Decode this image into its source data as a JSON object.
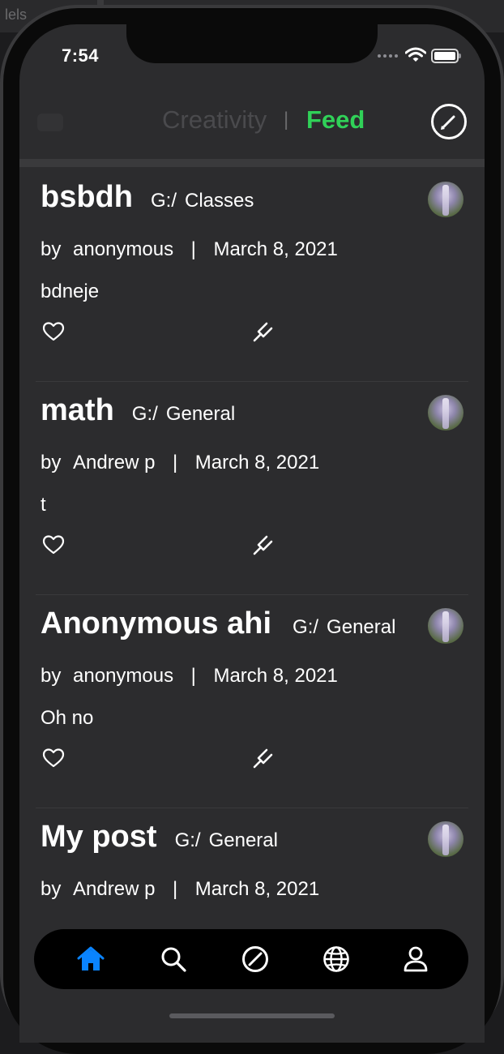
{
  "backdrop": {
    "text": "lels"
  },
  "status_bar": {
    "time": "7:54"
  },
  "header": {
    "segment_left": "Creativity",
    "separator": "|",
    "segment_right": "Feed",
    "accent_color": "#30d158",
    "compose_icon": "compose-icon"
  },
  "posts": [
    {
      "title": "bsbdh",
      "group_prefix": "G:/",
      "group": "Classes",
      "by": "by",
      "author": "anonymous",
      "separator": "|",
      "date": "March 8, 2021",
      "body": "bdneje"
    },
    {
      "title": "math",
      "group_prefix": "G:/",
      "group": "General",
      "by": "by",
      "author": "Andrew p",
      "separator": "|",
      "date": "March 8, 2021",
      "body": "t"
    },
    {
      "title": "Anonymous ahi",
      "group_prefix": "G:/",
      "group": "General",
      "by": "by",
      "author": "anonymous",
      "separator": "|",
      "date": "March 8, 2021",
      "body": "Oh no"
    },
    {
      "title": "My post",
      "group_prefix": "G:/",
      "group": "General",
      "by": "by",
      "author": "Andrew p",
      "separator": "|",
      "date": "March 8, 2021",
      "body": ""
    }
  ],
  "tabbar": {
    "active_color": "#0a84ff",
    "items": [
      "home-icon",
      "search-icon",
      "compass-icon",
      "globe-icon",
      "profile-icon"
    ]
  }
}
